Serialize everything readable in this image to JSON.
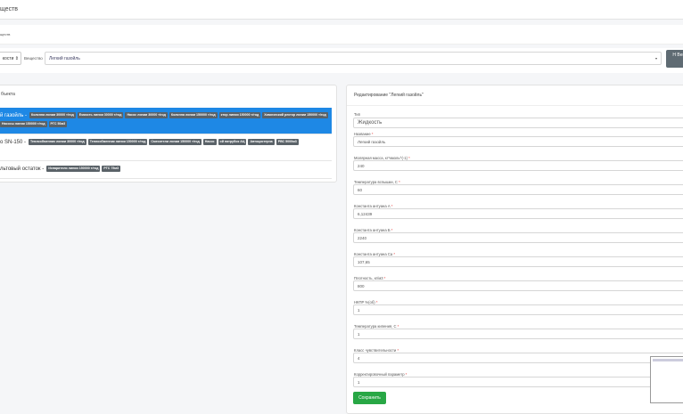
{
  "header": {
    "title": "ществ"
  },
  "panel": {
    "title": "ществ"
  },
  "filter": {
    "type_value": "кости",
    "substance_label": "Вещество",
    "substance_value": "Легкий газойль",
    "add_button": "Н Вещ"
  },
  "objects": {
    "title": "бъекта",
    "items": [
      {
        "name": "й газойль -",
        "active": true,
        "tags": [
          "Колонна линии 30000 т/год",
          "Емкость линии 30000 т/год",
          "Насос линии 30000 т/год",
          "Колонна линии 150000 т/год",
          "ктор линии 150000 т/год",
          "Химический рeктор линии 150000 т/год",
          "Насосы линии 150000 т/год",
          "РГС 50м3"
        ]
      },
      {
        "name": "о SN-150 -",
        "active": false,
        "tags": [
          "Теплообменник линии 30000 т/год",
          "Теплообменник линии 150000 т/год",
          "Смесители линии 150000 т/год",
          "Насос",
          "ой патрубок АЦ",
          "Автоцистерна",
          "РВС 5000м3"
        ]
      },
      {
        "name": "льтовый остаток -",
        "active": false,
        "tags": [
          "Испарители линии 150000 т/год",
          "РГС 75м3"
        ]
      }
    ]
  },
  "editor": {
    "title": "Редактирование \"Легкий газойль\"",
    "fields": [
      {
        "label": "Тип",
        "required": false,
        "value": "Жидкость"
      },
      {
        "label": "Название",
        "required": true,
        "value": "Легкий газойль"
      },
      {
        "label": "Молярная масса, кг*кмоль^(-1)",
        "required": true,
        "value": "240"
      },
      {
        "label": "Температура вспышки, С",
        "required": true,
        "value": "60"
      },
      {
        "label": "Константа антуана А",
        "required": true,
        "value": "6,12439"
      },
      {
        "label": "Константа антуана Б",
        "required": true,
        "value": "2240"
      },
      {
        "label": "Константа антуана Са",
        "required": true,
        "value": "107,65"
      },
      {
        "label": "Плотность, кг/м3",
        "required": true,
        "value": "800"
      },
      {
        "label": "НКПР %(об)",
        "required": true,
        "value": "1"
      },
      {
        "label": "Температура кипения, С",
        "required": true,
        "value": "1"
      },
      {
        "label": "Класс чувствительности",
        "required": true,
        "value": "4"
      },
      {
        "label": "Корректировочный параметр",
        "required": true,
        "value": "1"
      }
    ],
    "save_label": "Сохранить"
  },
  "colors": {
    "active": "#1e88e5",
    "tag": "#5a6268",
    "save": "#28a745"
  }
}
